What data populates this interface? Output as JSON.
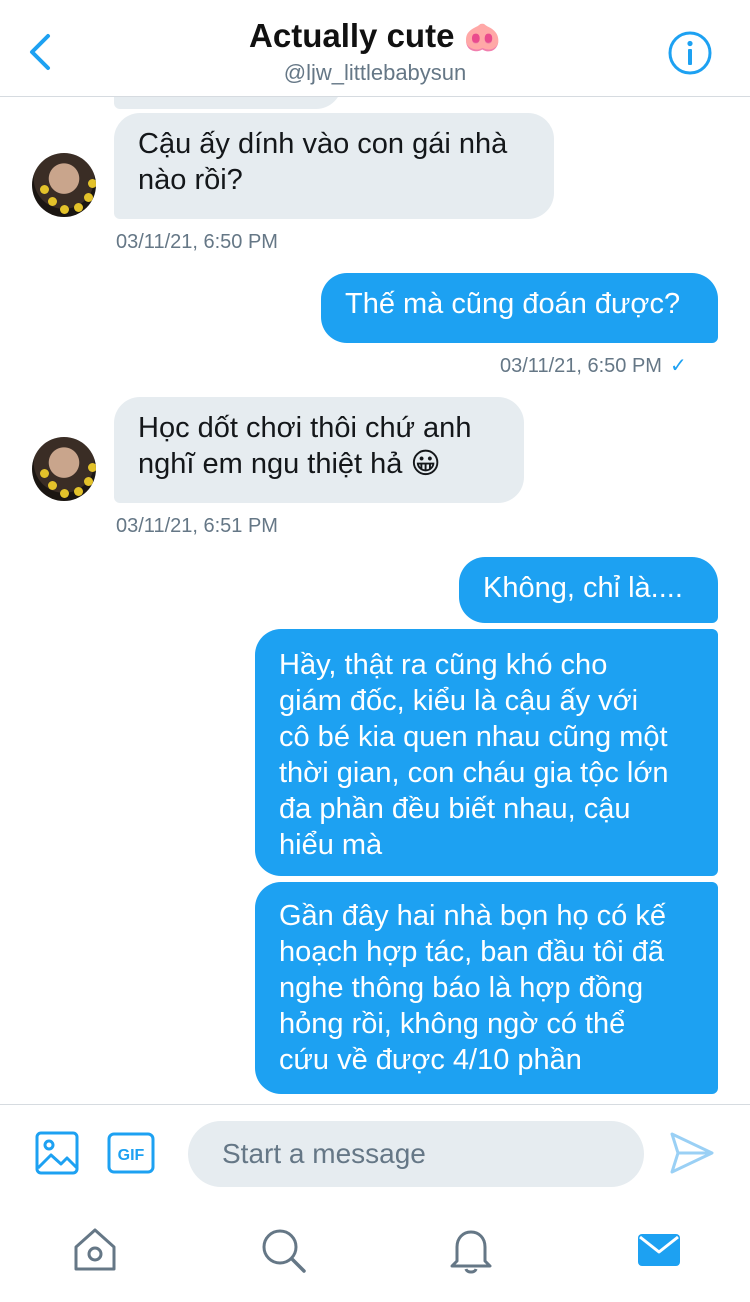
{
  "header": {
    "title": "Actually cute",
    "title_emoji": "🐽",
    "handle": "@ljw_littlebabysun",
    "back_icon": "chevron-left-icon",
    "info_icon": "info-icon"
  },
  "colors": {
    "accent": "#1da1f2",
    "incoming_bubble": "#e6ecf0",
    "muted_text": "#657786"
  },
  "messages": [
    {
      "direction": "in",
      "lines": [
        "Cậu ấy dính vào con gái nhà",
        "nào rồi?"
      ],
      "time": "03/11/21, 6:50 PM"
    },
    {
      "direction": "out",
      "lines": [
        "Thế mà cũng đoán được?"
      ],
      "time": "03/11/21, 6:50 PM",
      "status": "✓"
    },
    {
      "direction": "in",
      "lines": [
        "Học dốt chơi thôi chứ anh",
        "nghĩ em ngu thiệt hả 😀"
      ],
      "time": "03/11/21, 6:51 PM"
    },
    {
      "direction": "out",
      "lines": [
        "Không, chỉ là...."
      ]
    },
    {
      "direction": "out",
      "lines": [
        "Hầy, thật ra cũng khó cho",
        "giám đốc, kiểu là cậu ấy với",
        "cô bé kia quen nhau cũng một",
        "thời gian, con cháu gia tộc lớn",
        "đa phần đều biết nhau, cậu",
        "hiểu mà"
      ]
    },
    {
      "direction": "out",
      "lines": [
        "Gần đây hai nhà bọn họ có kế",
        "hoạch hợp tác, ban đầu tôi đã",
        "nghe thông báo là hợp đồng",
        "hỏng rồi, không ngờ có thể",
        "cứu về được 4/10 phần"
      ]
    }
  ],
  "composer": {
    "placeholder": "Start a message",
    "media_icon": "image-icon",
    "gif_label": "GIF",
    "send_icon": "send-icon"
  },
  "tabs": [
    {
      "name": "home",
      "icon": "home-icon",
      "active": false
    },
    {
      "name": "search",
      "icon": "search-icon",
      "active": false
    },
    {
      "name": "notifications",
      "icon": "bell-icon",
      "active": false
    },
    {
      "name": "messages",
      "icon": "mail-icon",
      "active": true
    }
  ]
}
